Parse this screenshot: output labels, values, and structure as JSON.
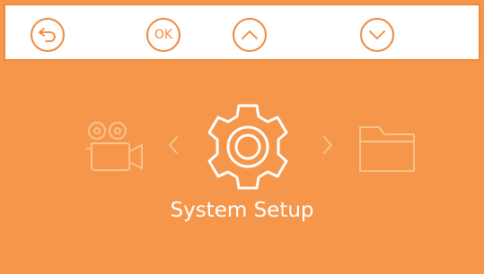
{
  "toolbar": {
    "buttons": [
      {
        "icon": "back-icon"
      },
      {
        "label": "OK"
      },
      {
        "icon": "chevron-up-icon"
      },
      {
        "icon": "chevron-down-icon"
      }
    ]
  },
  "menu": {
    "items": [
      {
        "icon": "video-camera-icon"
      },
      {
        "icon": "gear-icon",
        "selected": true
      },
      {
        "icon": "folder-icon"
      }
    ],
    "selected_label": "System Setup"
  },
  "colors": {
    "accent": "#F0883A",
    "screen_background": "#F5964A",
    "toolbar_background": "#FFFFFF",
    "icon_active": "#FFFFFF",
    "icon_inactive": "#FAC38F"
  }
}
